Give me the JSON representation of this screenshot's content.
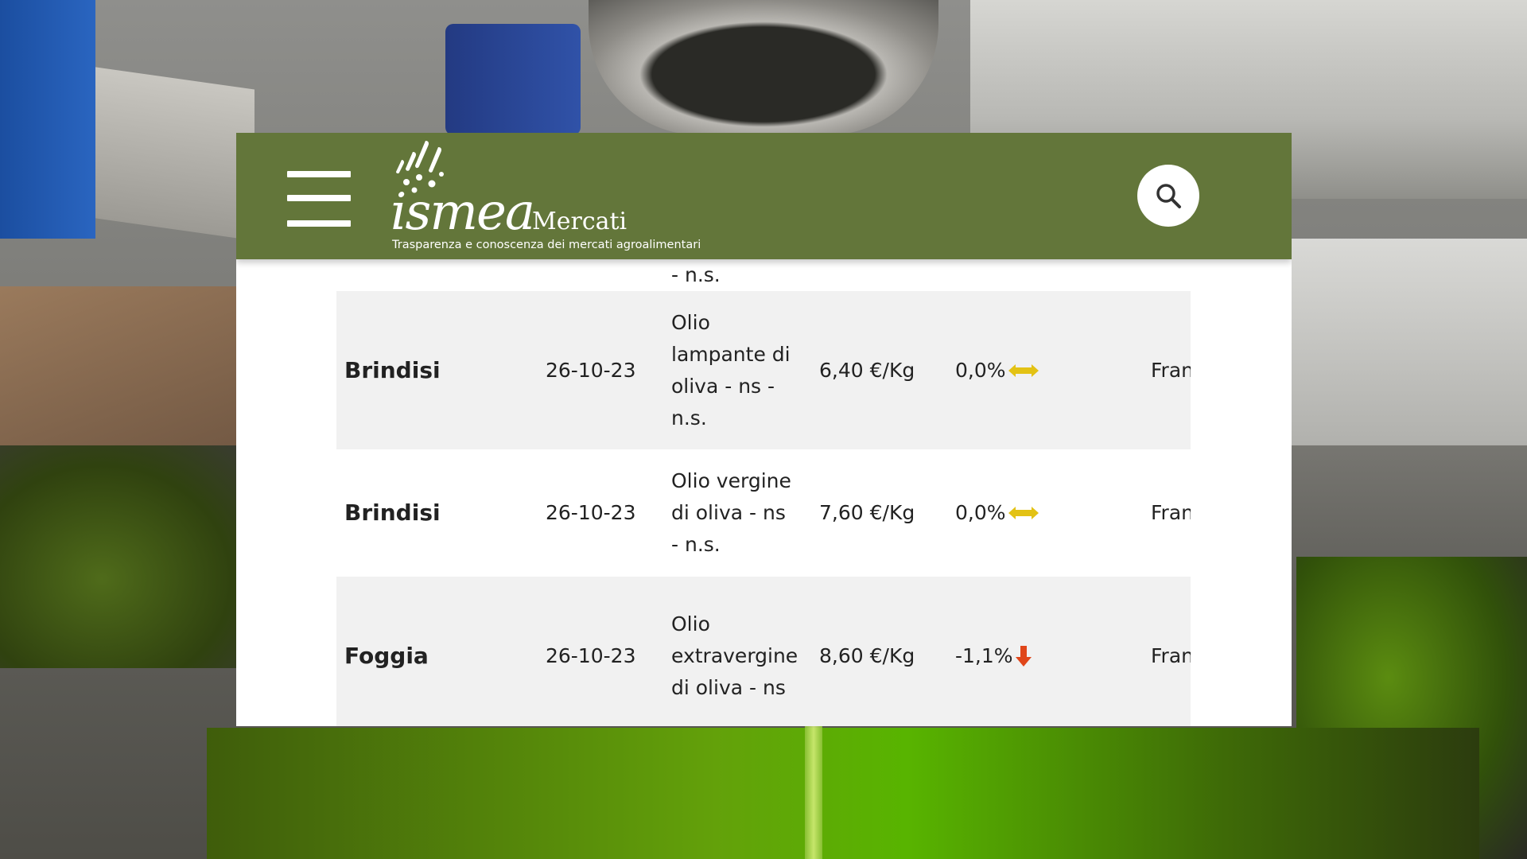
{
  "header": {
    "brand_word": "ismea",
    "brand_sub": "Mercati",
    "tagline": "Trasparenza e conoscenza dei mercati agroalimentari",
    "menu_icon": "hamburger-menu-icon",
    "search_icon": "search-icon",
    "background_color": "#63763a"
  },
  "table": {
    "rows": [
      {
        "city": "",
        "date": "",
        "product": "di oliva - ns - n.s.",
        "price": "",
        "variation": "",
        "trend": "",
        "place": ""
      },
      {
        "city": "Brindisi",
        "date": "26-10-23",
        "product": "Olio lampante di oliva - ns - n.s.",
        "price": "6,40 €/Kg",
        "variation": "0,0%",
        "trend": "stable",
        "place": "Fran"
      },
      {
        "city": "Brindisi",
        "date": "26-10-23",
        "product": "Olio vergine di oliva - ns - n.s.",
        "price": "7,60 €/Kg",
        "variation": "0,0%",
        "trend": "stable",
        "place": "Fran"
      },
      {
        "city": "Foggia",
        "date": "26-10-23",
        "product": "Olio extravergine di oliva - ns",
        "price": "8,60 €/Kg",
        "variation": "-1,1%",
        "trend": "down",
        "place": "Fran"
      }
    ]
  },
  "colors": {
    "stable_arrow": "#e3c214",
    "down_arrow": "#e0461a",
    "alt_row": "#f1f1f1"
  }
}
